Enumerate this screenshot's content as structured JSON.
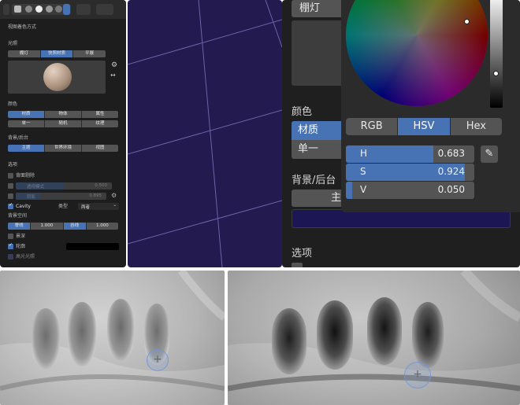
{
  "shading_panel": {
    "title": "视图着色方式",
    "lighting": {
      "label": "光照",
      "options": [
        "棚灯",
        "快照材质",
        "平展"
      ],
      "selected": "快照材质"
    },
    "color": {
      "label": "颜色",
      "options_row1": [
        "材质",
        "物体",
        "属性"
      ],
      "options_row2": [
        "单一",
        "随机",
        "纹理"
      ],
      "selected": "材质"
    },
    "background": {
      "label": "背景/后台",
      "options": [
        "主题",
        "世界环境",
        "视图"
      ],
      "selected": "主题"
    },
    "options": {
      "label": "选项",
      "backface_culling": "背面剔除",
      "xray_label": "透视模式",
      "xray_value": "0.500",
      "shadow_label": "阴影",
      "shadow_value": "0.895",
      "cavity_label": "Cavity",
      "cavity_type_label": "类型",
      "cavity_type_value": "两者",
      "cavity_color_label": "背景空间",
      "ridge_label": "脊线",
      "ridge_value": "1.000",
      "valley_label": "谷线",
      "valley_value": "1.000",
      "depth_of_field": "景深",
      "outline": "轮廓",
      "specular": "高光光照"
    }
  },
  "color_popup": {
    "top_button": "棚灯",
    "color_label": "颜色",
    "color_options": [
      "材质",
      "单一"
    ],
    "selected": "材质",
    "background_label": "背景/后台",
    "background_button": "主题",
    "options_label": "选项",
    "picker": {
      "tabs": [
        "RGB",
        "HSV",
        "Hex"
      ],
      "active_tab": "HSV",
      "h_label": "H",
      "h_value": "0.683",
      "s_label": "S",
      "s_value": "0.924",
      "v_label": "V",
      "v_value": "0.050",
      "swatch_color": "#1d1655"
    }
  },
  "colors": {
    "accent": "#4772b3",
    "viewport_bg": "#231b50"
  }
}
